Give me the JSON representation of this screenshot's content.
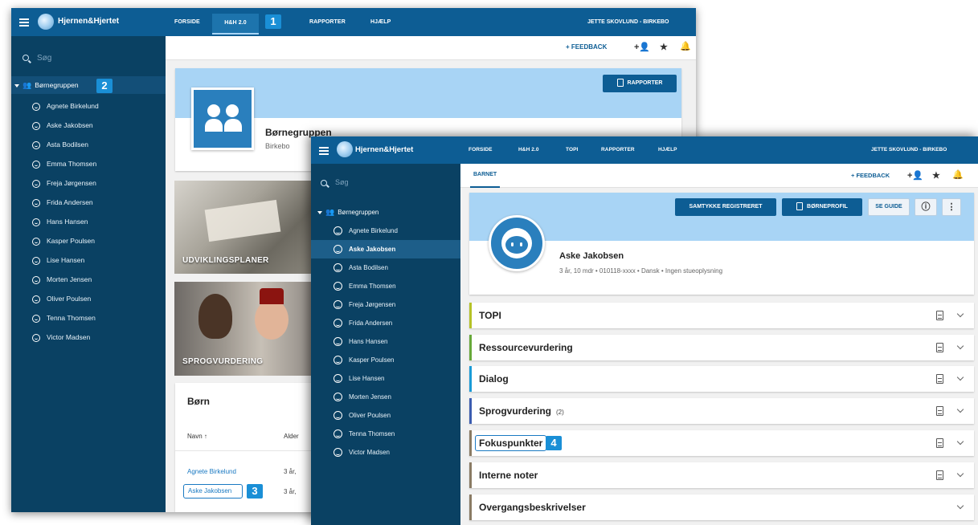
{
  "colors": {
    "topbar": "#0d5d94",
    "sidebar": "#0a4163",
    "accent": "#1a8fd6",
    "header_band": "#a8d4f5"
  },
  "back": {
    "brand": "Hjernen&Hjertet",
    "nav": {
      "forside": "FORSIDE",
      "hh": "H&H 2.0",
      "rapporter": "RAPPORTER",
      "hjaelp": "HJÆLP"
    },
    "user": "JETTE SKOVLUND - BIRKEBO",
    "search_placeholder": "Søg",
    "group": "Børnegruppen",
    "children": [
      "Agnete Birkelund",
      "Aske Jakobsen",
      "Asta Bodilsen",
      "Emma Thomsen",
      "Freja Jørgensen",
      "Frida Andersen",
      "Hans Hansen",
      "Kasper Poulsen",
      "Lise Hansen",
      "Morten Jensen",
      "Oliver Poulsen",
      "Tenna Thomsen",
      "Victor Madsen"
    ],
    "feedback": "FEEDBACK",
    "rapporter_button": "RAPPORTER",
    "group_title": "Børnegruppen",
    "group_subtitle": "Birkebo",
    "tiles": [
      "UDVIKLINGSPLANER",
      "SPROGVURDERING"
    ],
    "born": {
      "title": "Børn",
      "col_name": "Navn",
      "col_age": "Alder",
      "rows": [
        {
          "name": "Agnete Birkelund",
          "age": "3 år,"
        },
        {
          "name": "Aske Jakobsen",
          "age": "3 år,"
        }
      ]
    }
  },
  "front": {
    "brand": "Hjernen&Hjertet",
    "nav": {
      "forside": "FORSIDE",
      "hh": "H&H 2.0",
      "topi": "TOPI",
      "rapporter": "RAPPORTER",
      "hjaelp": "HJÆLP"
    },
    "user": "JETTE SKOVLUND - BIRKEBO",
    "search_placeholder": "Søg",
    "group": "Børnegruppen",
    "children": [
      "Agnete Birkelund",
      "Aske Jakobsen",
      "Asta Bodilsen",
      "Emma Thomsen",
      "Freja Jørgensen",
      "Frida Andersen",
      "Hans Hansen",
      "Kasper Poulsen",
      "Lise Hansen",
      "Morten Jensen",
      "Oliver Poulsen",
      "Tenna Thomsen",
      "Victor Madsen"
    ],
    "tab": "BARNET",
    "feedback": "FEEDBACK",
    "buttons": {
      "samtykke": "SAMTYKKE REGISTRERET",
      "bornprofil": "BØRNEPROFIL",
      "guide": "SE GUIDE"
    },
    "child_name": "Aske Jakobsen",
    "child_details": "3 år, 10 mdr • 010118-xxxx • Dansk • Ingen stueoplysning",
    "sections": [
      {
        "title": "TOPI",
        "count": "",
        "color": "#b5c227"
      },
      {
        "title": "Ressourcevurdering",
        "count": "",
        "color": "#67a83a"
      },
      {
        "title": "Dialog",
        "count": "",
        "color": "#1a9bd7"
      },
      {
        "title": "Sprogvurdering",
        "count": "(2)",
        "color": "#3b5cb0"
      },
      {
        "title": "Fokuspunkter",
        "count": "",
        "color": "#8a7b64"
      },
      {
        "title": "Interne noter",
        "count": "",
        "color": "#8a7b64"
      },
      {
        "title": "Overgangsbeskrivelser",
        "count": "",
        "color": "#8a7b64"
      }
    ]
  },
  "callouts": [
    "1",
    "2",
    "3",
    "4"
  ]
}
